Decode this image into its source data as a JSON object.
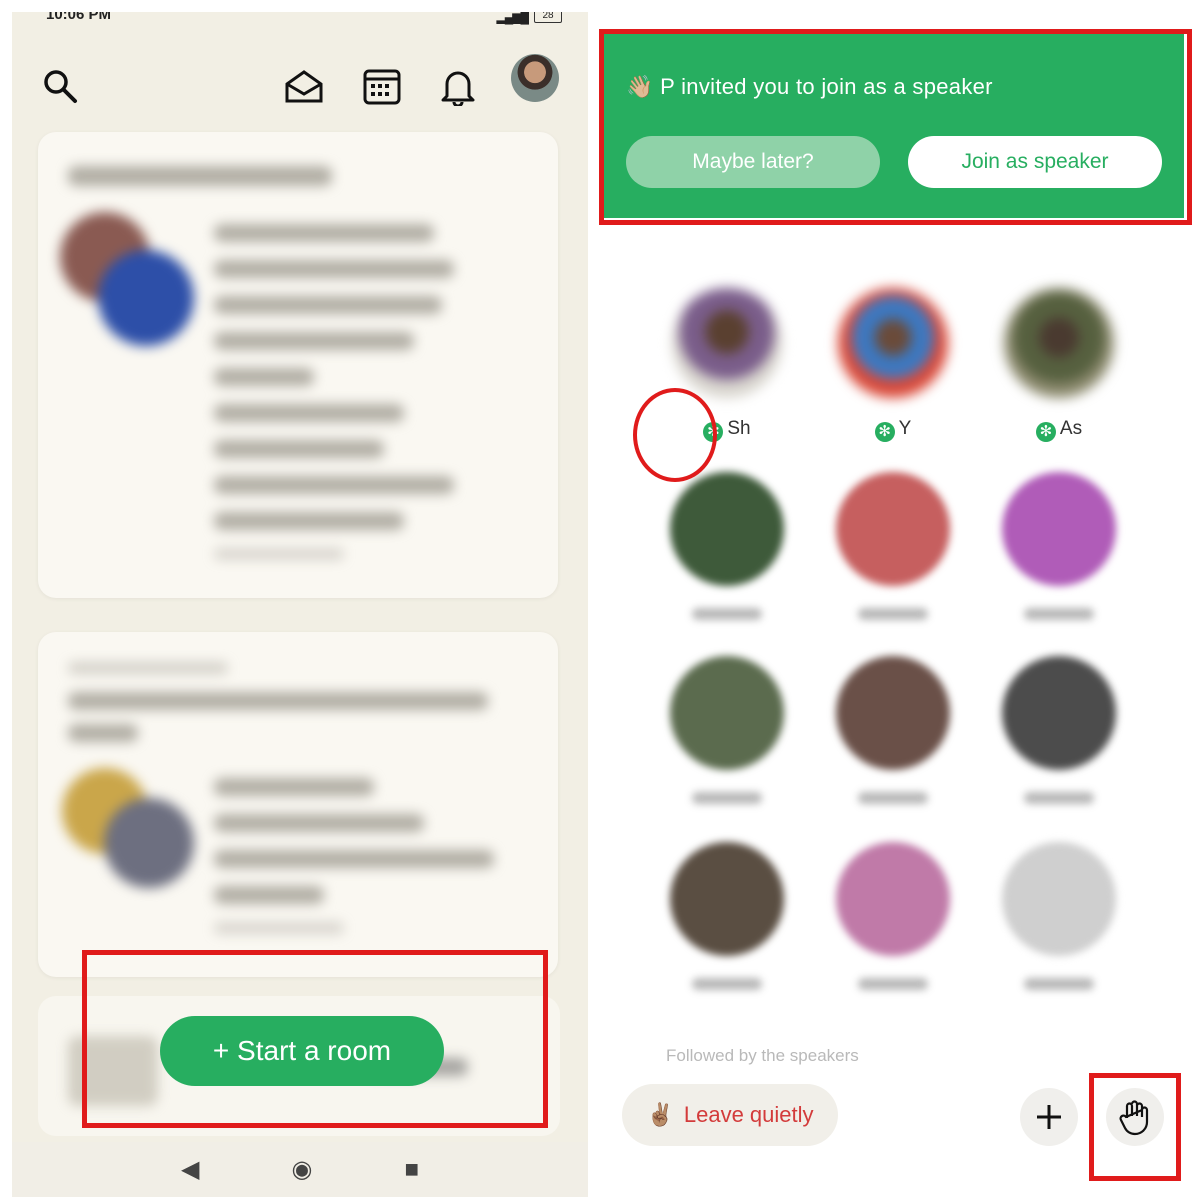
{
  "left": {
    "status_time": "10:06 PM",
    "battery": "28",
    "start_room_label": "+ Start a room"
  },
  "right": {
    "invite": {
      "message": "P invited you to join as a speaker",
      "maybe_later_label": "Maybe later?",
      "join_label": "Join as speaker"
    },
    "speakers": [
      {
        "name": "Sh"
      },
      {
        "name": "Y"
      },
      {
        "name": "As"
      }
    ],
    "followed_label": "Followed by the speakers",
    "leave_label": "Leave quietly"
  },
  "colors": {
    "accent_green": "#27ae60",
    "annotation_red": "#e01b1b",
    "leave_red": "#d33b3b"
  },
  "icons": [
    "search-icon",
    "envelope-icon",
    "calendar-icon",
    "bell-icon",
    "plus-icon",
    "raise-hand-icon",
    "back-icon",
    "home-icon",
    "recents-icon"
  ]
}
